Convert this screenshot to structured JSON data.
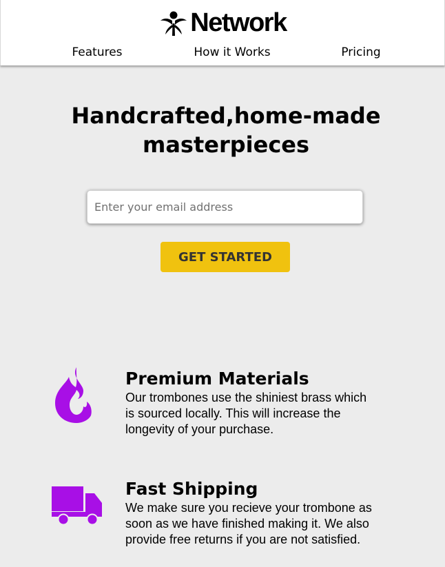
{
  "brand": {
    "name": "Network"
  },
  "nav": {
    "items": [
      {
        "label": "Features"
      },
      {
        "label": "How it Works"
      },
      {
        "label": "Pricing"
      }
    ]
  },
  "hero": {
    "title_line1": "Handcrafted,home-made",
    "title_line2": "masterpieces",
    "email_placeholder": "Enter your email address",
    "cta_label": "GET STARTED"
  },
  "features": [
    {
      "icon": "fire-icon",
      "title": "Premium Materials",
      "desc_lines": [
        "Our trombones use the shiniest brass which",
        "is sourced locally. This will increase the",
        "longevity of your purchase."
      ]
    },
    {
      "icon": "truck-icon",
      "title": "Fast Shipping",
      "desc_lines": [
        "We make sure you recieve your trombone as",
        "soon as we have finished making it. We also",
        "provide free returns if you are not satisfied."
      ]
    }
  ],
  "colors": {
    "background": "#ececec",
    "header": "#ffffff",
    "accent": "#f0c20f",
    "icon": "#a80fe6"
  }
}
